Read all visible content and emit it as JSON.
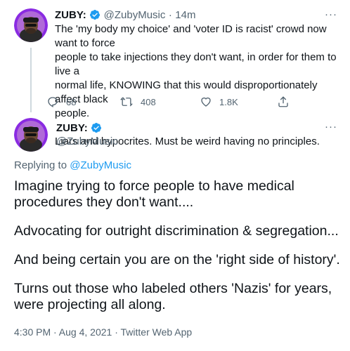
{
  "tweet1": {
    "name": "ZUBY:",
    "handle": "@ZubyMusic",
    "time": "14m",
    "separator": "·",
    "more": "···",
    "text_lines": [
      "The 'my body my choice' and 'voter ID is racist' crowd now want to force",
      "people to take injections they don't want, in order for them to live a",
      "normal life, KNOWING that this would disproportionately affect black",
      "people.",
      "",
      "Liars and hypocrites. Must be weird having no principles."
    ],
    "actions": {
      "replies": "68",
      "retweets": "408",
      "likes": "1.8K"
    }
  },
  "tweet2": {
    "name": "ZUBY:",
    "handle": "@ZubyMusic",
    "more": "···",
    "replying_prefix": "Replying to",
    "replying_to": "@ZubyMusic",
    "paragraphs": [
      "Imagine trying to force people to have medical procedures they don't want....",
      "Advocating for outright discrimination & segregation...",
      "And being certain you are on the 'right side of history'.",
      "Turns out those who labeled others 'Nazis' for years, were projecting all along."
    ],
    "timestamp": "4:30 PM · Aug 4, 2021 · Twitter Web App"
  },
  "colors": {
    "accent": "#1d9bf0",
    "secondary_text": "#536471",
    "avatar_bg": "#8a2be2"
  }
}
